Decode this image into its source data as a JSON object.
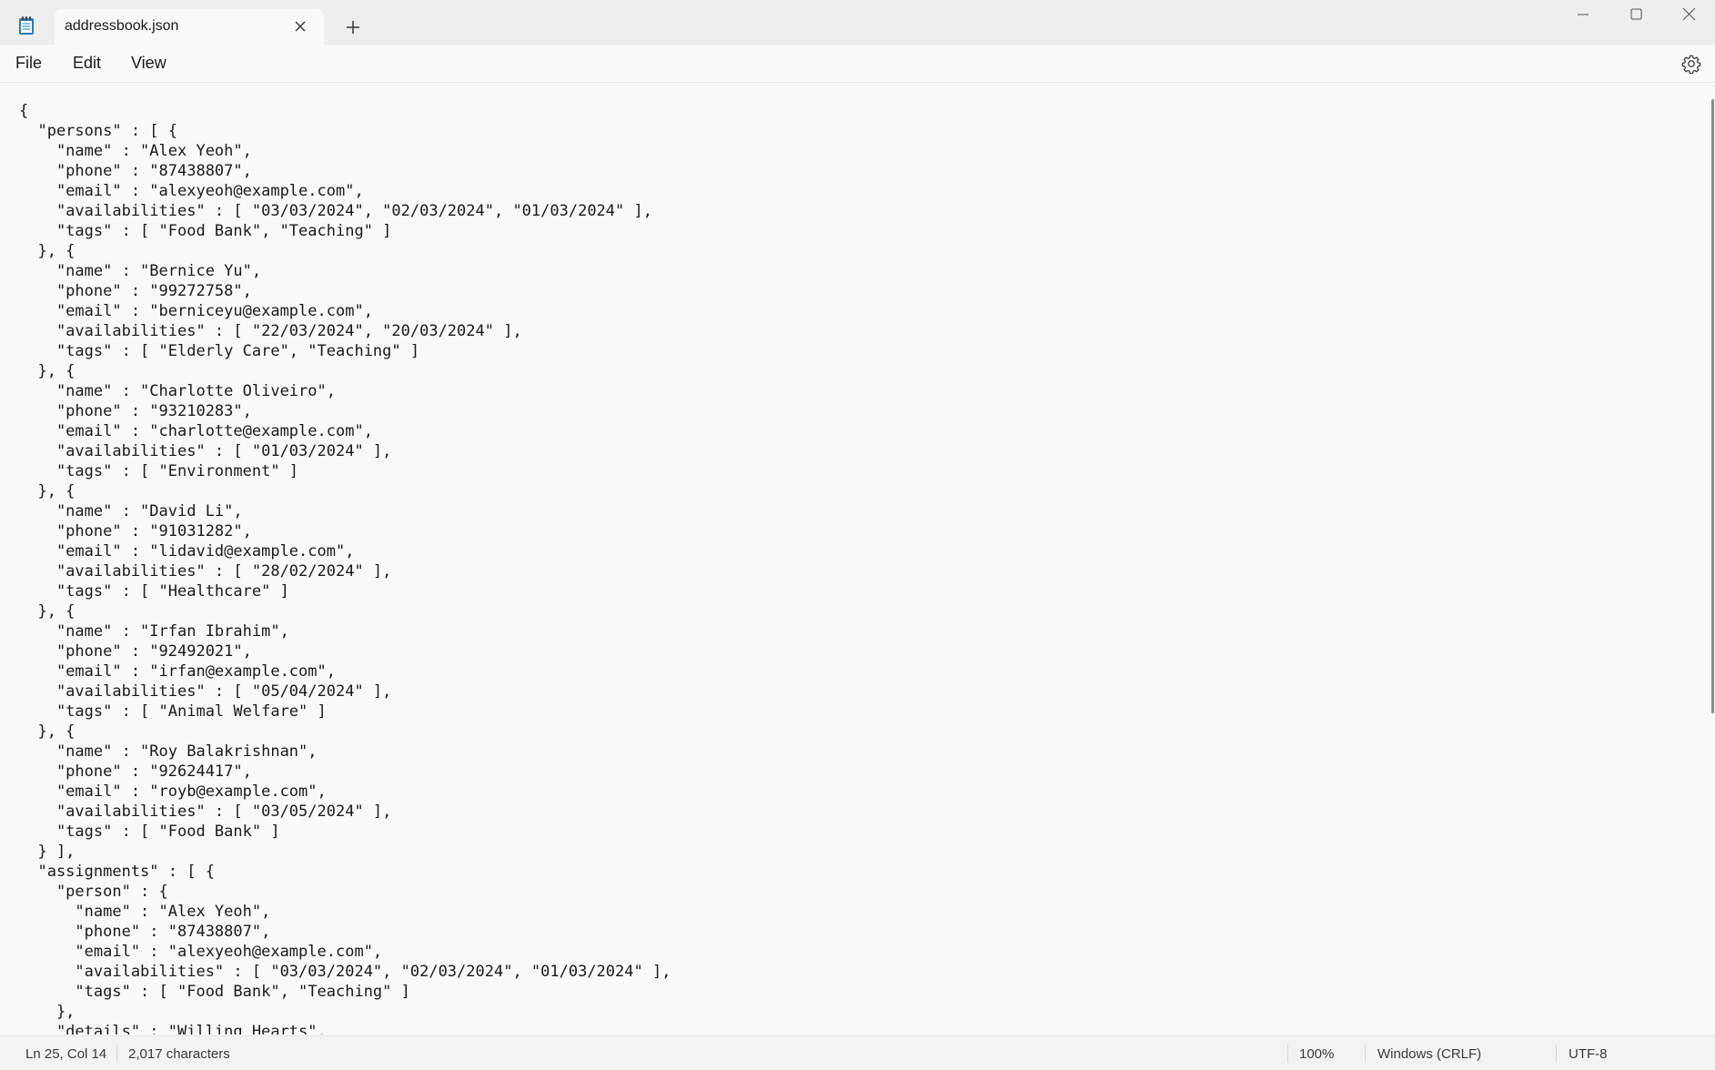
{
  "tab": {
    "title": "addressbook.json",
    "close_icon": "close-icon",
    "new_tab_icon": "plus-icon"
  },
  "window_controls": {
    "minimize_icon": "minimize-icon",
    "maximize_icon": "maximize-icon",
    "close_icon": "close-icon"
  },
  "menu": {
    "file": "File",
    "edit": "Edit",
    "view": "View",
    "settings_icon": "gear-icon"
  },
  "editor": {
    "lines": [
      "{",
      "  \"persons\" : [ {",
      "    \"name\" : \"Alex Yeoh\",",
      "    \"phone\" : \"87438807\",",
      "    \"email\" : \"alexyeoh@example.com\",",
      "    \"availabilities\" : [ \"03/03/2024\", \"02/03/2024\", \"01/03/2024\" ],",
      "    \"tags\" : [ \"Food Bank\", \"Teaching\" ]",
      "  }, {",
      "    \"name\" : \"Bernice Yu\",",
      "    \"phone\" : \"99272758\",",
      "    \"email\" : \"berniceyu@example.com\",",
      "    \"availabilities\" : [ \"22/03/2024\", \"20/03/2024\" ],",
      "    \"tags\" : [ \"Elderly Care\", \"Teaching\" ]",
      "  }, {",
      "    \"name\" : \"Charlotte Oliveiro\",",
      "    \"phone\" : \"93210283\",",
      "    \"email\" : \"charlotte@example.com\",",
      "    \"availabilities\" : [ \"01/03/2024\" ],",
      "    \"tags\" : [ \"Environment\" ]",
      "  }, {",
      "    \"name\" : \"David Li\",",
      "    \"phone\" : \"91031282\",",
      "    \"email\" : \"lidavid@example.com\",",
      "    \"availabilities\" : [ \"28/02/2024\" ],",
      "    \"tags\" : [ \"Healthcare\" ]",
      "  }, {",
      "    \"name\" : \"Irfan Ibrahim\",",
      "    \"phone\" : \"92492021\",",
      "    \"email\" : \"irfan@example.com\",",
      "    \"availabilities\" : [ \"05/04/2024\" ],",
      "    \"tags\" : [ \"Animal Welfare\" ]",
      "  }, {",
      "    \"name\" : \"Roy Balakrishnan\",",
      "    \"phone\" : \"92624417\",",
      "    \"email\" : \"royb@example.com\",",
      "    \"availabilities\" : [ \"03/05/2024\" ],",
      "    \"tags\" : [ \"Food Bank\" ]",
      "  } ],",
      "  \"assignments\" : [ {",
      "    \"person\" : {",
      "      \"name\" : \"Alex Yeoh\",",
      "      \"phone\" : \"87438807\",",
      "      \"email\" : \"alexyeoh@example.com\",",
      "      \"availabilities\" : [ \"03/03/2024\", \"02/03/2024\", \"01/03/2024\" ],",
      "      \"tags\" : [ \"Food Bank\", \"Teaching\" ]",
      "    },",
      "    \"details\" : \"Willing Hearts\","
    ]
  },
  "status": {
    "position": "Ln 25, Col 14",
    "characters": "2,017 characters",
    "zoom": "100%",
    "line_ending": "Windows (CRLF)",
    "encoding": "UTF-8"
  }
}
